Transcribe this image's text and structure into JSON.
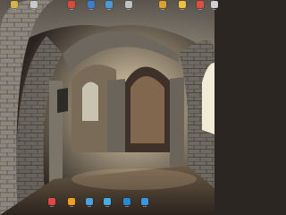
{
  "desktop": {
    "wallpaper": {
      "description": "arched stone vaulted cellar corridor",
      "colors": {
        "stone": "#8f8a80",
        "shadow": "#2a2622",
        "light": "#f2e6c6",
        "floor": "#5a4a3a"
      }
    },
    "top_icons": [
      {
        "label": "icon",
        "icon": "folder-icon",
        "color": "#d7b24a"
      },
      {
        "label": "icon",
        "icon": "app-icon",
        "color": "#c9c9c9"
      },
      {
        "label": "icon",
        "icon": "app-icon",
        "color": "#d84a3a"
      },
      {
        "label": "icon",
        "icon": "app-icon",
        "color": "#3b7fd1"
      },
      {
        "label": "icon",
        "icon": "app-icon",
        "color": "#4a9ad8"
      },
      {
        "label": "icon",
        "icon": "app-icon",
        "color": "#c0c0c0"
      },
      {
        "label": "icon",
        "icon": "app-icon",
        "color": "#e0a030"
      },
      {
        "label": "icon",
        "icon": "app-icon",
        "color": "#f0c040"
      },
      {
        "label": "icon",
        "icon": "app-icon",
        "color": "#e05040"
      },
      {
        "label": "icon",
        "icon": "app-icon",
        "color": "#d0d0d0"
      }
    ],
    "bottom_icons": [
      {
        "label": "icon",
        "icon": "app-icon",
        "color": "#e04848"
      },
      {
        "label": "icon",
        "icon": "app-icon",
        "color": "#f0a020"
      },
      {
        "label": "icon",
        "icon": "app-icon",
        "color": "#4aa0e0"
      },
      {
        "label": "icon",
        "icon": "app-icon",
        "color": "#40b0e8"
      },
      {
        "label": "icon",
        "icon": "app-icon",
        "color": "#2a88d8"
      },
      {
        "label": "icon",
        "icon": "app-icon",
        "color": "#3a98e0"
      }
    ]
  }
}
